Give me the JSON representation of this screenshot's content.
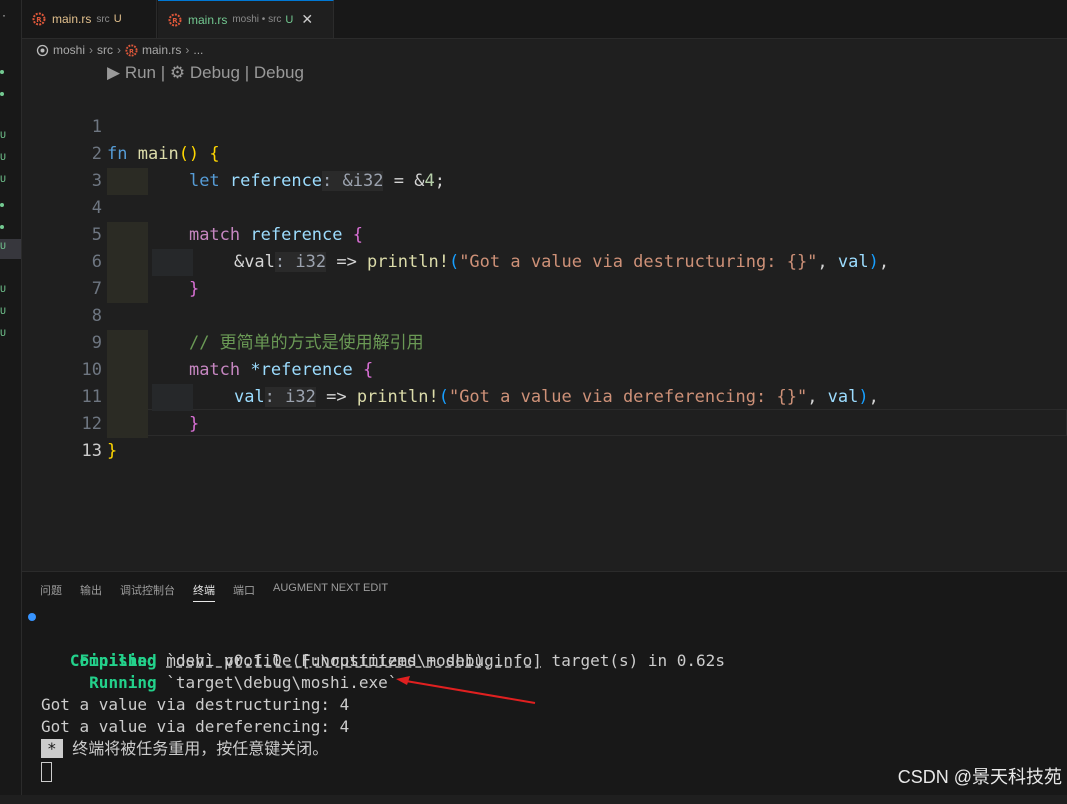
{
  "tabs": [
    {
      "file": "main.rs",
      "desc": "src",
      "badge": "U"
    },
    {
      "file": "main.rs",
      "desc": "moshi • src",
      "badge": "U",
      "close": "✕"
    }
  ],
  "breadcrumb": {
    "root": "moshi",
    "dir": "src",
    "file": "main.rs",
    "more": "..."
  },
  "codelens": {
    "run": "Run",
    "debug1": "Debug",
    "debug2": "Debug"
  },
  "lines": {
    "l1": "1",
    "l2": "2",
    "l3": "3",
    "l4": "4",
    "l5": "5",
    "l6": "6",
    "l7": "7",
    "l8": "8",
    "l9": "9",
    "l10": "10",
    "l11": "11",
    "l12": "12",
    "l13": "13"
  },
  "code": {
    "fn": "fn",
    "main": "main",
    "let": "let",
    "reference": "reference",
    "type_ref": ": &i32",
    "eq": " = ",
    "amp": "&",
    "four": "4",
    "semi": ";",
    "match": "match",
    "amp_val": "&val",
    "hint_i32": ": i32",
    "arrow": " => ",
    "println": "println!",
    "str1": "\"Got a value via destructuring: {}\"",
    "comma": ", ",
    "val": "val",
    "comment": "// 更简单的方式是使用解引用",
    "deref": "*reference",
    "str2": "\"Got a value via dereferencing: {}\""
  },
  "panel": {
    "tabs": [
      "问题",
      "输出",
      "调试控制台",
      "终端",
      "端口",
      "AUGMENT NEXT EDIT"
    ],
    "active_tab": "终端"
  },
  "terminal": {
    "compiling_label": "Compiling",
    "compiling_text": " moshi v0.1.0 (F:\\rustitems\\moshi)",
    "finished_label": "Finished",
    "finished_profile": "`dev` profile [unoptimized + debuginfo]",
    "finished_text": " target(s) in 0.62s",
    "running_label": "Running",
    "running_text": " `target\\debug\\moshi.exe`",
    "out1": "Got a value via destructuring: 4",
    "out2": "Got a value via dereferencing: 4",
    "star": "*",
    "reuse_msg": " 终端将被任务重用，按任意键关闭。"
  },
  "watermark": "CSDN @景天科技苑"
}
